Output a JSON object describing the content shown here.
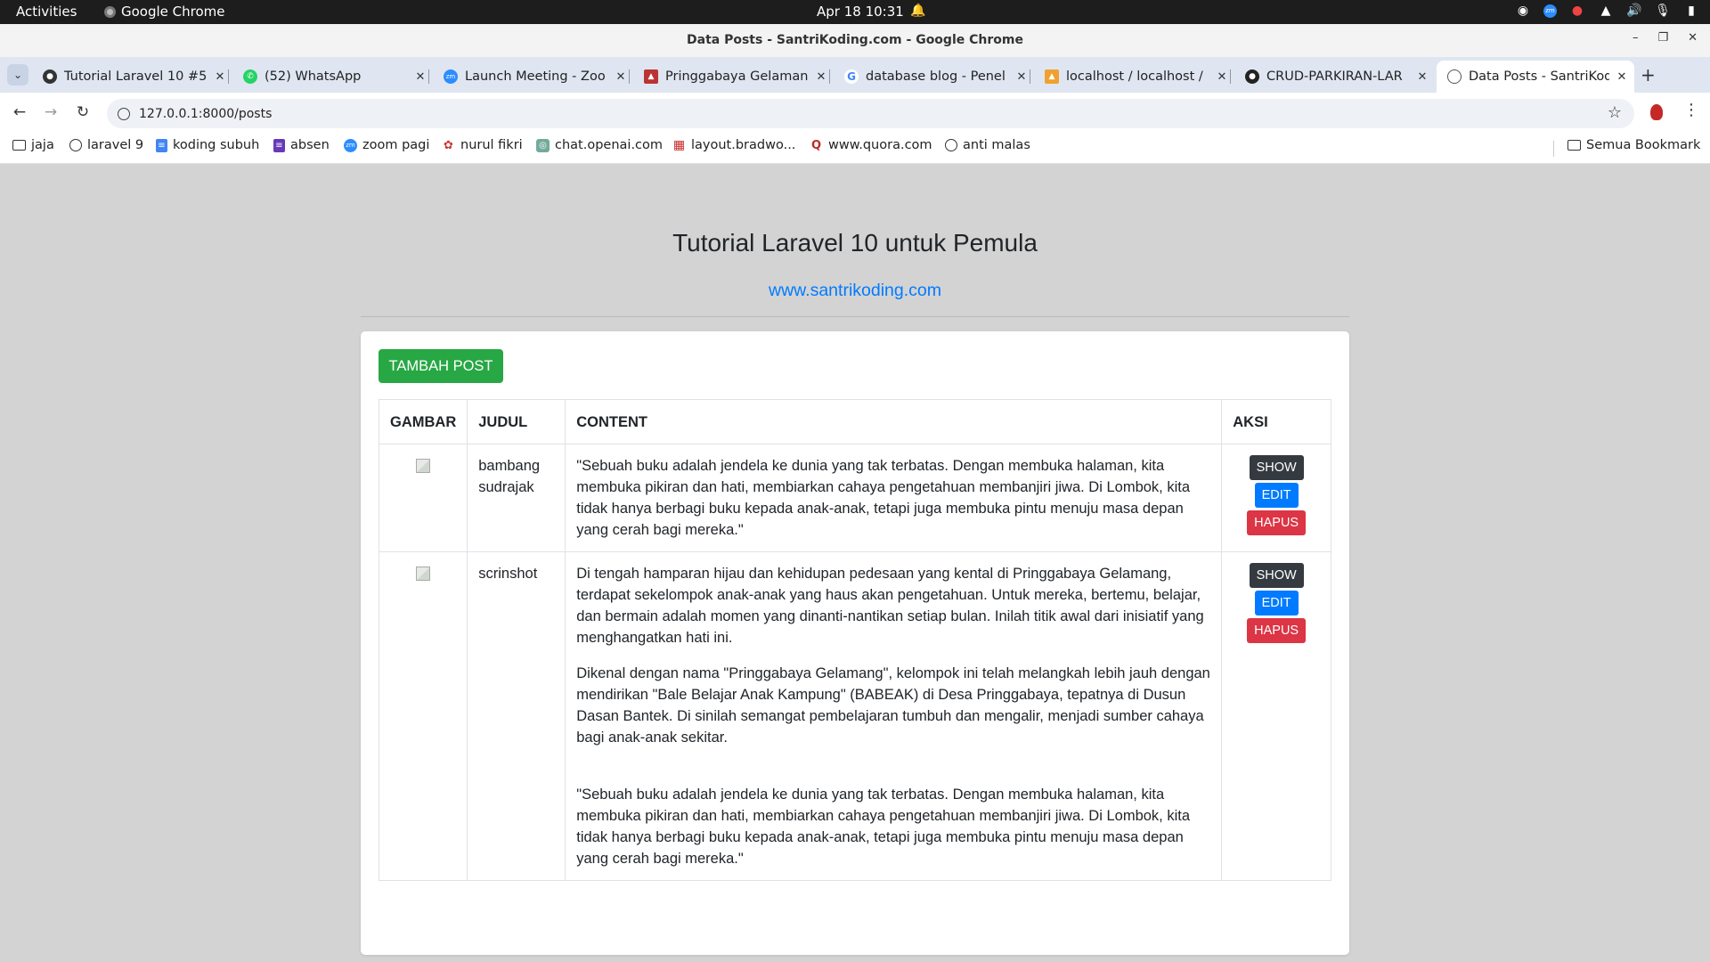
{
  "system_bar": {
    "activities": "Activities",
    "app_name": "Google Chrome",
    "clock": "Apr 18  10:31"
  },
  "window": {
    "title": "Data Posts - SantriKoding.com - Google Chrome"
  },
  "tabs": [
    {
      "label": "Tutorial Laravel 10 #5",
      "icon": "github-icon",
      "active": false
    },
    {
      "label": "(52) WhatsApp",
      "icon": "whatsapp-icon",
      "active": false
    },
    {
      "label": "Launch Meeting - Zoo",
      "icon": "zoom-icon",
      "active": false
    },
    {
      "label": "Pringgabaya Gelamang",
      "icon": "site-icon",
      "active": false
    },
    {
      "label": "database blog - Penel",
      "icon": "google-icon",
      "active": false
    },
    {
      "label": "localhost / localhost /",
      "icon": "phpmyadmin-icon",
      "active": false
    },
    {
      "label": "CRUD-PARKIRAN-LAR",
      "icon": "github-icon",
      "active": false
    },
    {
      "label": "Data Posts - SantriKod",
      "icon": "globe-icon",
      "active": true
    }
  ],
  "address_bar": {
    "url": "127.0.0.1:8000/posts"
  },
  "bookmarks": [
    {
      "label": "jaja",
      "icon": "folder-icon"
    },
    {
      "label": "laravel 9",
      "icon": "globe-icon"
    },
    {
      "label": "koding subuh",
      "icon": "doc-icon"
    },
    {
      "label": "absen",
      "icon": "form-icon"
    },
    {
      "label": "zoom pagi",
      "icon": "zoom-icon"
    },
    {
      "label": "nurul fikri",
      "icon": "site-icon"
    },
    {
      "label": "chat.openai.com",
      "icon": "openai-icon"
    },
    {
      "label": "layout.bradwo...",
      "icon": "grid-icon"
    },
    {
      "label": "www.quora.com",
      "icon": "quora-icon"
    },
    {
      "label": "anti malas",
      "icon": "globe-icon"
    }
  ],
  "all_bookmarks": "Semua Bookmark",
  "page": {
    "heading": "Tutorial Laravel 10 untuk Pemula",
    "site_link": "www.santrikoding.com",
    "add_button": "TAMBAH POST",
    "columns": [
      "GAMBAR",
      "JUDUL",
      "CONTENT",
      "AKSI"
    ],
    "action_labels": {
      "show": "SHOW",
      "edit": "EDIT",
      "delete": "HAPUS"
    },
    "rows": [
      {
        "title": "bambang sudrajak",
        "content": [
          "\"Sebuah buku adalah jendela ke dunia yang tak terbatas. Dengan membuka halaman, kita membuka pikiran dan hati, membiarkan cahaya pengetahuan membanjiri jiwa. Di Lombok, kita tidak hanya berbagi buku kepada anak-anak, tetapi juga membuka pintu menuju masa depan yang cerah bagi mereka.\""
        ]
      },
      {
        "title": "scrinshot",
        "content": [
          "Di tengah hamparan hijau dan kehidupan pedesaan yang kental di Pringgabaya Gelamang, terdapat sekelompok anak-anak yang haus akan pengetahuan. Untuk mereka, bertemu, belajar, dan bermain adalah momen yang dinanti-nantikan setiap bulan. Inilah titik awal dari inisiatif yang menghangatkan hati ini.",
          "Dikenal dengan nama \"Pringgabaya Gelamang\", kelompok ini telah melangkah lebih jauh dengan mendirikan \"Bale Belajar Anak Kampung\" (BABEAK) di Desa Pringgabaya, tepatnya di Dusun Dasan Bantek. Di sinilah semangat pembelajaran tumbuh dan mengalir, menjadi sumber cahaya bagi anak-anak sekitar.",
          "\"Sebuah buku adalah jendela ke dunia yang tak terbatas. Dengan membuka halaman, kita membuka pikiran dan hati, membiarkan cahaya pengetahuan membanjiri jiwa. Di Lombok, kita tidak hanya berbagi buku kepada anak-anak, tetapi juga membuka pintu menuju masa depan yang cerah bagi mereka.\""
        ]
      }
    ]
  },
  "colors": {
    "success": "#28a745",
    "primary": "#007bff",
    "danger": "#dc3545",
    "dark": "#343a40",
    "page_bg": "#d3d3d3"
  }
}
